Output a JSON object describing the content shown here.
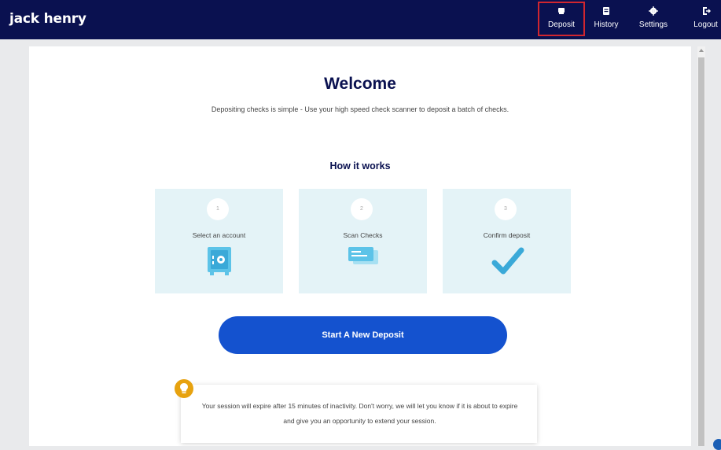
{
  "header": {
    "logo": "jack henry",
    "nav": [
      {
        "label": "Deposit",
        "icon": "deposit-icon"
      },
      {
        "label": "History",
        "icon": "history-icon"
      },
      {
        "label": "Settings",
        "icon": "gear-icon"
      },
      {
        "label": "Logout",
        "icon": "logout-icon"
      }
    ]
  },
  "main": {
    "title": "Welcome",
    "subtitle": "Depositing checks is simple - Use your high speed check scanner to deposit a batch of checks.",
    "how_title": "How it works",
    "steps": [
      {
        "number": "1",
        "label": "Select an account",
        "icon": "safe-icon"
      },
      {
        "number": "2",
        "label": "Scan Checks",
        "icon": "checks-icon"
      },
      {
        "number": "3",
        "label": "Confirm deposit",
        "icon": "checkmark-icon"
      }
    ],
    "cta_label": "Start A New Deposit",
    "notice": "Your session will expire after 15 minutes of inactivity. Don't worry, we will let you know if it is about to expire and give you an opportunity to extend your session."
  },
  "colors": {
    "header_bg": "#0a1150",
    "accent": "#1452cf",
    "step_bg": "#e4f3f7",
    "active_outline": "#d1262f",
    "bulb": "#e7a20f"
  }
}
